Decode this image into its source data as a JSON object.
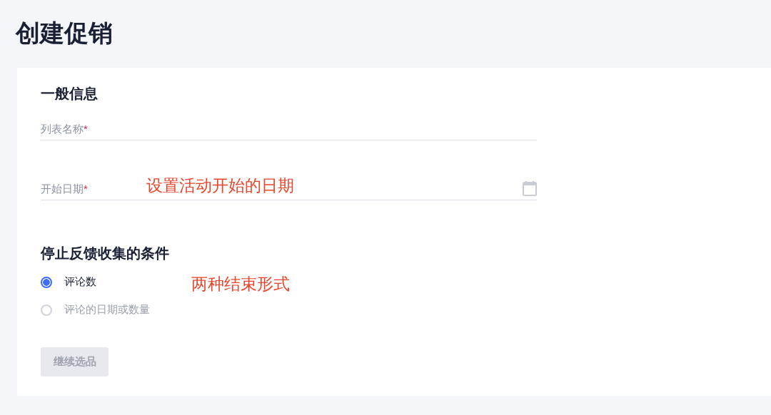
{
  "page_title": "创建促销",
  "general": {
    "heading": "一般信息",
    "fields": [
      {
        "label": "列表名称",
        "required_mark": "*",
        "kind": "text"
      },
      {
        "label": "开始日期",
        "required_mark": "*",
        "kind": "date"
      }
    ]
  },
  "stop_condition": {
    "heading": "停止反馈收集的条件",
    "options": [
      {
        "label": "评论数",
        "selected": true
      },
      {
        "label": "评论的日期或数量",
        "selected": false
      }
    ]
  },
  "continue_button": {
    "label": "继续选品",
    "disabled": true
  },
  "annotations": [
    {
      "text": "设置活动开始的日期"
    },
    {
      "text": "两种结束形式"
    }
  ]
}
